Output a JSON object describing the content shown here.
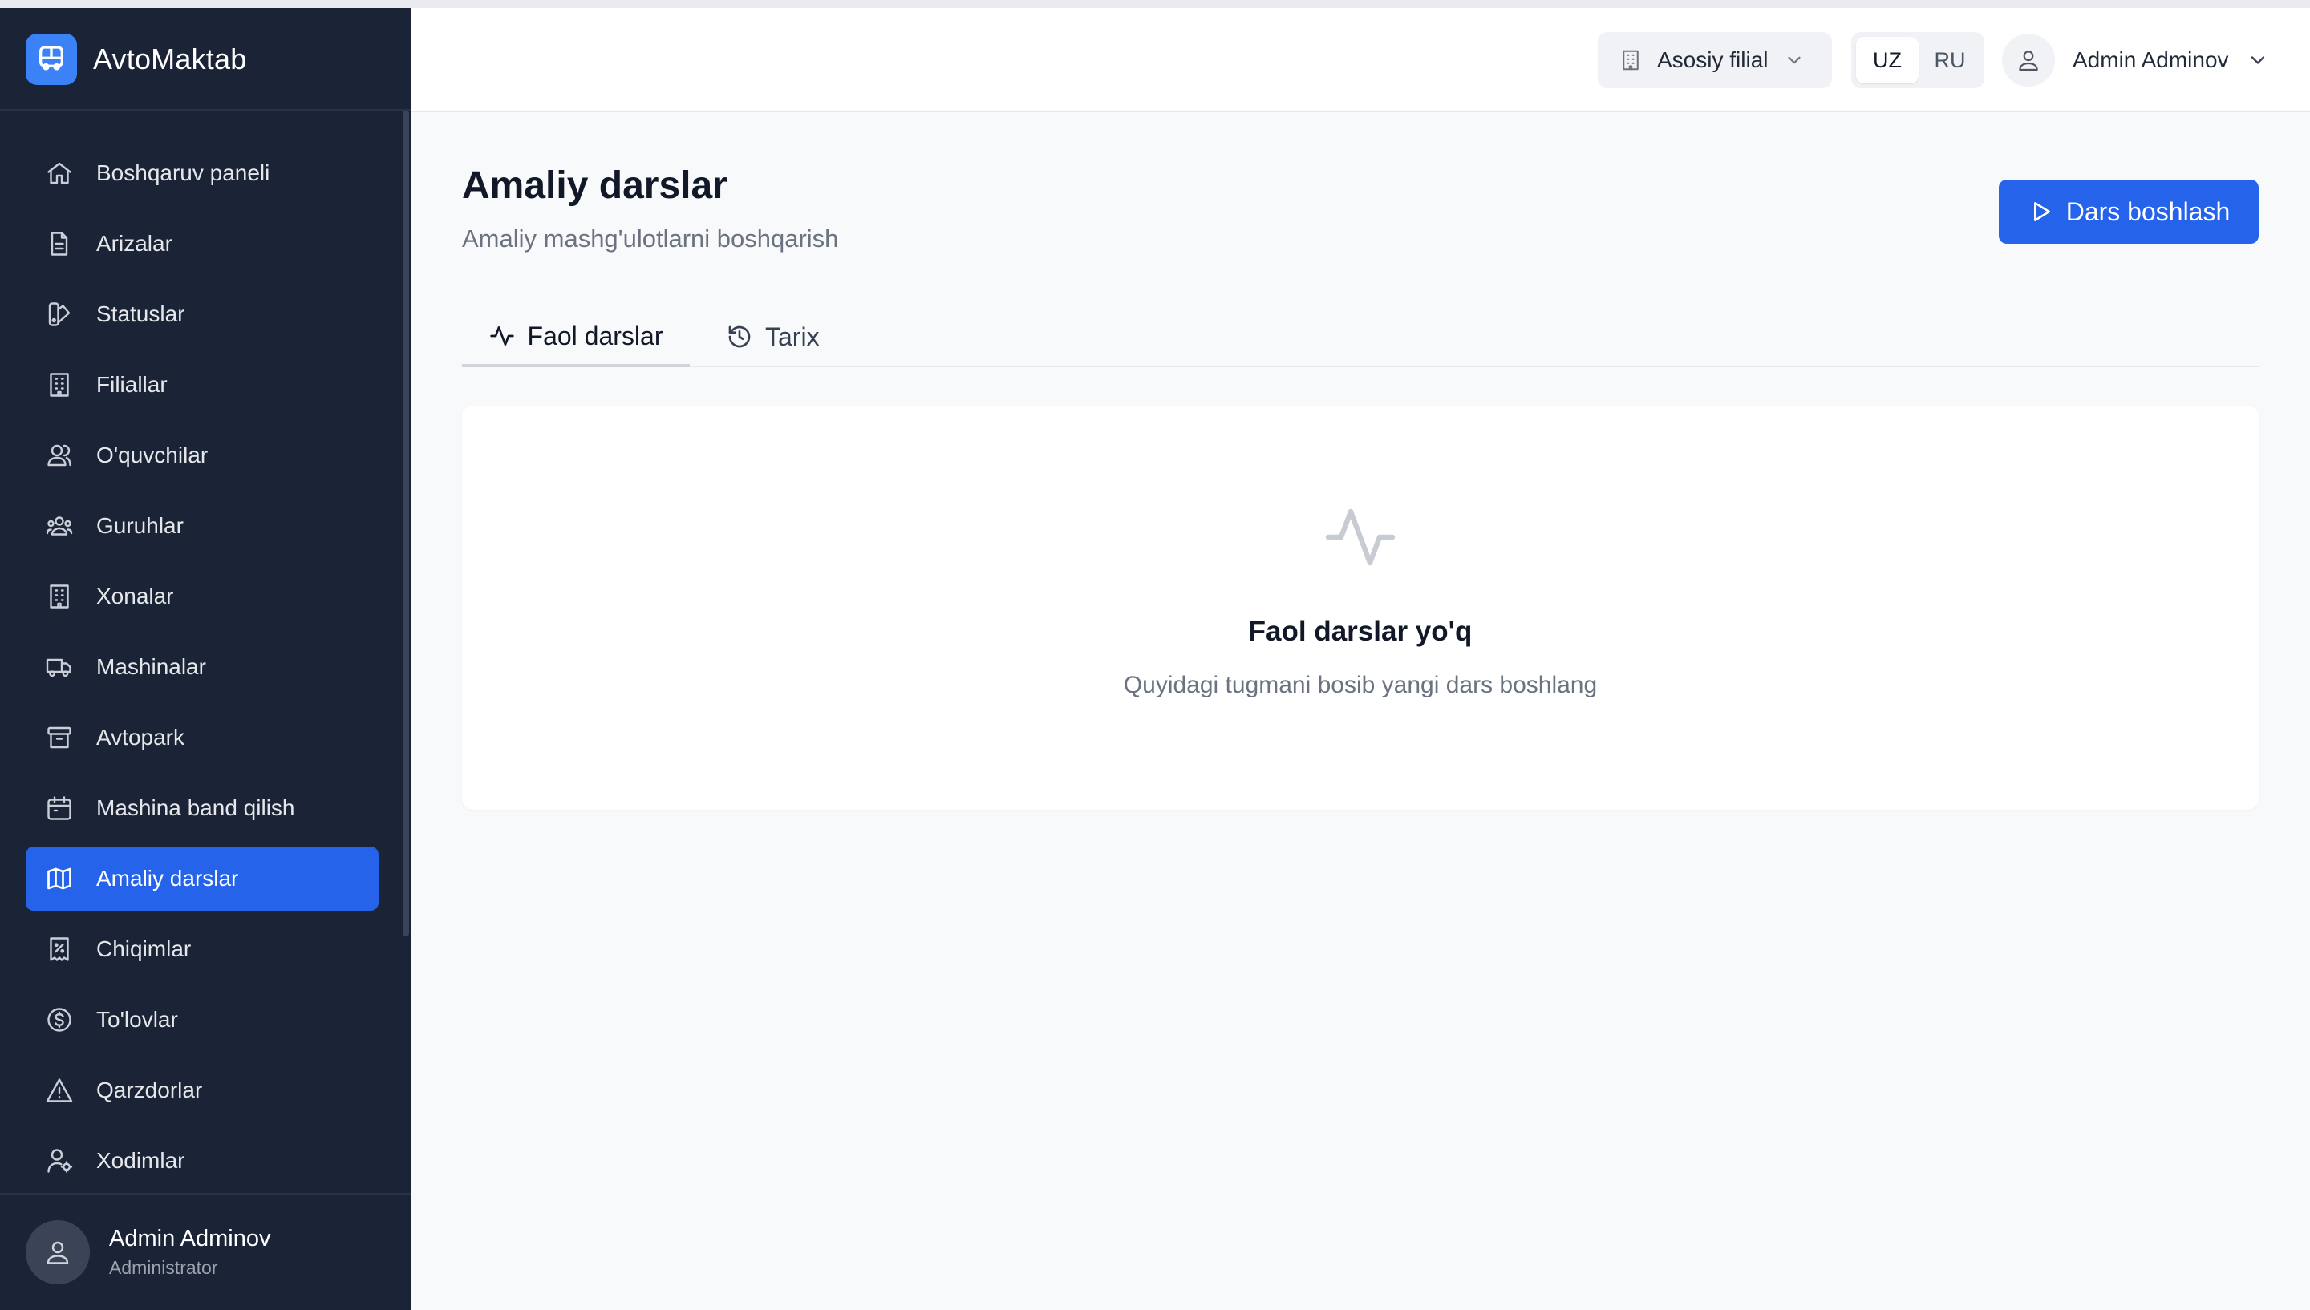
{
  "app": {
    "name": "AvtoMaktab",
    "logo_icon": "bus-icon",
    "accent": "#2563eb"
  },
  "sidebar": {
    "items": [
      {
        "label": "Boshqaruv paneli",
        "icon": "home-icon"
      },
      {
        "label": "Arizalar",
        "icon": "document-icon"
      },
      {
        "label": "Statuslar",
        "icon": "swatch-icon"
      },
      {
        "label": "Filiallar",
        "icon": "building-icon"
      },
      {
        "label": "O'quvchilar",
        "icon": "users-icon"
      },
      {
        "label": "Guruhlar",
        "icon": "user-group-icon"
      },
      {
        "label": "Xonalar",
        "icon": "building-icon"
      },
      {
        "label": "Mashinalar",
        "icon": "truck-icon"
      },
      {
        "label": "Avtopark",
        "icon": "archive-icon"
      },
      {
        "label": "Mashina band qilish",
        "icon": "calendar-icon"
      },
      {
        "label": "Amaliy darslar",
        "icon": "map-icon",
        "active": true
      },
      {
        "label": "Chiqimlar",
        "icon": "receipt-percent-icon"
      },
      {
        "label": "To'lovlar",
        "icon": "dollar-circle-icon"
      },
      {
        "label": "Qarzdorlar",
        "icon": "warning-icon"
      },
      {
        "label": "Xodimlar",
        "icon": "user-cog-icon"
      }
    ],
    "footer": {
      "name": "Admin Adminov",
      "role": "Administrator"
    }
  },
  "header": {
    "branch": "Asosiy filial",
    "languages": [
      "UZ",
      "RU"
    ],
    "active_language": "UZ",
    "user": "Admin Adminov"
  },
  "main": {
    "title": "Amaliy darslar",
    "subtitle": "Amaliy mashg'ulotlarni boshqarish",
    "start_button": "Dars boshlash",
    "tabs": [
      {
        "label": "Faol darslar",
        "icon": "activity-icon",
        "active": true
      },
      {
        "label": "Tarix",
        "icon": "history-icon"
      }
    ],
    "empty": {
      "title": "Faol darslar yo'q",
      "subtitle": "Quyidagi tugmani bosib yangi dars boshlang"
    }
  }
}
